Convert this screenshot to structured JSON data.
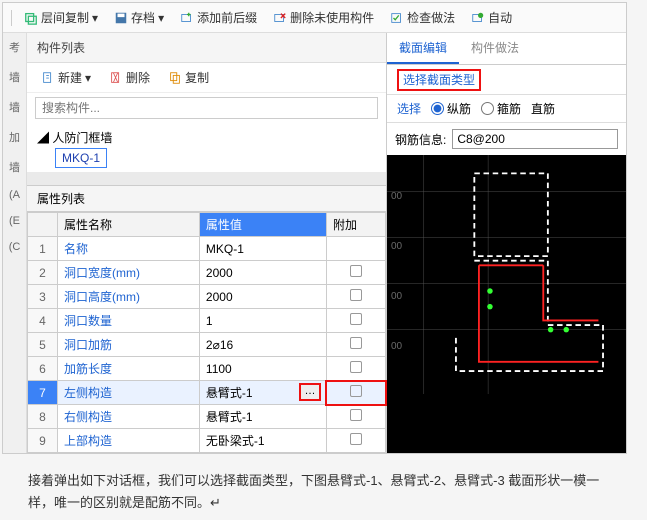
{
  "toolbar": {
    "copy_floor": "层间复制",
    "save": "存档",
    "add_prefix": "添加前后缀",
    "delete_unused": "删除未使用构件",
    "check_make": "检查做法",
    "auto": "自动"
  },
  "left": {
    "panel_title": "构件列表",
    "new_btn": "新建",
    "del_btn": "删除",
    "copy_btn": "复制",
    "search_placeholder": "搜索构件...",
    "tree_root": "人防门框墙",
    "tree_child": "MKQ-1",
    "side_labels": [
      "考",
      "墙",
      "墙",
      "加",
      "墙",
      "(A",
      "(E",
      "(C"
    ]
  },
  "props": {
    "title": "属性列表",
    "headers": {
      "name": "属性名称",
      "value": "属性值",
      "extra": "附加"
    },
    "rows": [
      {
        "n": "1",
        "name": "名称",
        "val": "MKQ-1",
        "chk": false
      },
      {
        "n": "2",
        "name": "洞口宽度(mm)",
        "val": "2000",
        "chk": true
      },
      {
        "n": "3",
        "name": "洞口高度(mm)",
        "val": "2000",
        "chk": true
      },
      {
        "n": "4",
        "name": "洞口数量",
        "val": "1",
        "chk": true
      },
      {
        "n": "5",
        "name": "洞口加筋",
        "val": "2⌀16",
        "chk": true
      },
      {
        "n": "6",
        "name": "加筋长度",
        "val": "1100",
        "chk": true
      },
      {
        "n": "7",
        "name": "左侧构造",
        "val": "悬臂式-1",
        "chk": true,
        "hl": true,
        "ellipsis": true
      },
      {
        "n": "8",
        "name": "右侧构造",
        "val": "悬臂式-1",
        "chk": true
      },
      {
        "n": "9",
        "name": "上部构造",
        "val": "无卧梁式-1",
        "chk": true
      }
    ]
  },
  "right": {
    "tabs": {
      "edit": "截面编辑",
      "method": "构件做法"
    },
    "select_type": "选择截面类型",
    "opts": {
      "select": "选择",
      "longitudinal": "纵筋",
      "stirrup": "箍筋",
      "straight": "直筋"
    },
    "rebar_label": "钢筋信息:",
    "rebar_value": "C8@200",
    "ticks": [
      "00",
      "00",
      "00",
      "00"
    ]
  },
  "desc": "接着弹出如下对话框，我们可以选择截面类型，下图悬臂式-1、悬臂式-2、悬臂式-3 截面形状一模一样，唯一的区别就是配筋不同。↵"
}
